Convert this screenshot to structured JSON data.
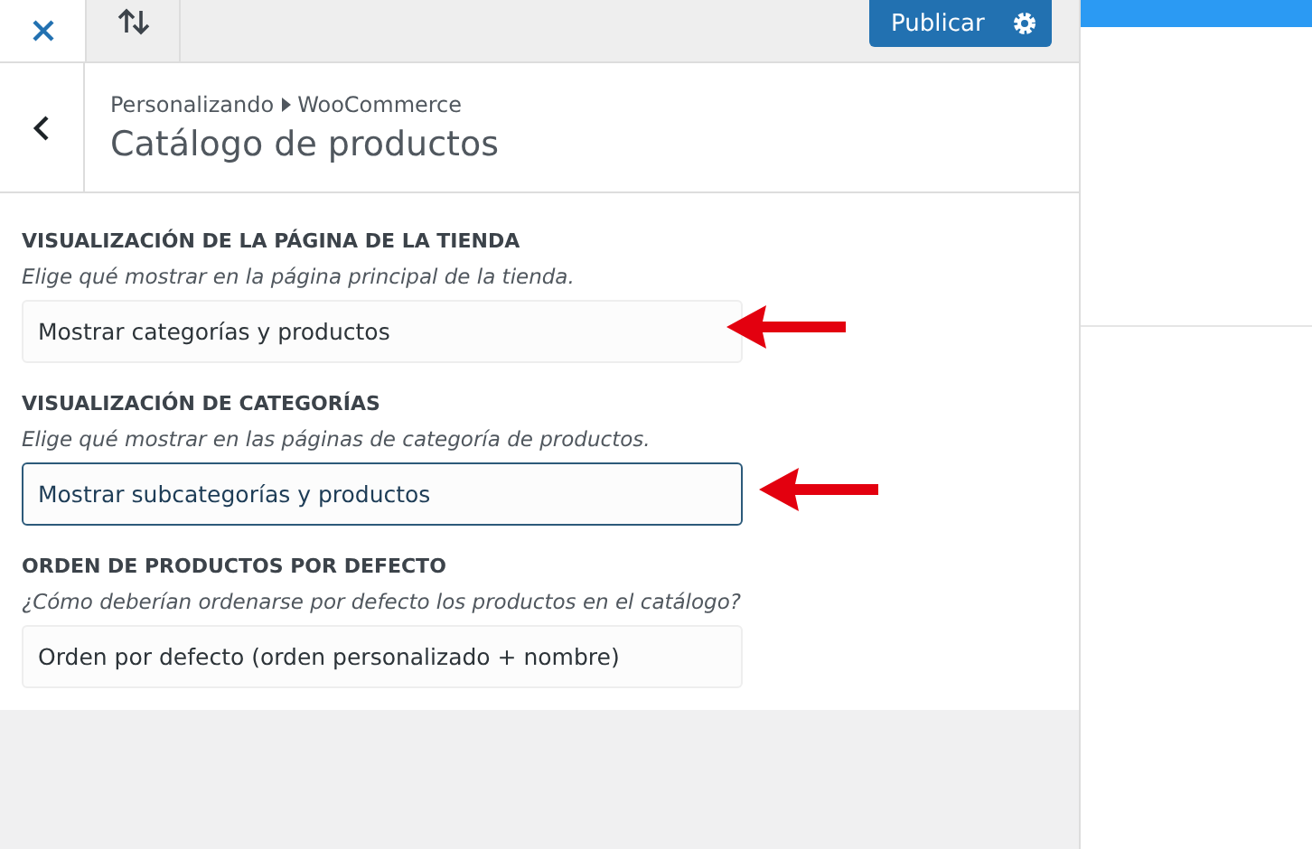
{
  "toolbar": {
    "publish_label": "Publicar"
  },
  "header": {
    "breadcrumb": [
      "Personalizando",
      "WooCommerce"
    ],
    "title": "Catálogo de productos"
  },
  "settings": [
    {
      "label": "VISUALIZACIÓN DE LA PÁGINA DE LA TIENDA",
      "description": "Elige qué mostrar en la página principal de la tienda.",
      "value": "Mostrar categorías y productos",
      "focused": false,
      "arrow": true
    },
    {
      "label": "VISUALIZACIÓN DE CATEGORÍAS",
      "description": "Elige qué mostrar en las páginas de categoría de productos.",
      "value": "Mostrar subcategorías y productos",
      "focused": true,
      "arrow": true
    },
    {
      "label": "ORDEN DE PRODUCTOS POR DEFECTO",
      "description": "¿Cómo deberían ordenarse por defecto los productos en el catálogo?",
      "value": "Orden por defecto (orden personalizado + nombre)",
      "focused": false,
      "arrow": false
    }
  ]
}
